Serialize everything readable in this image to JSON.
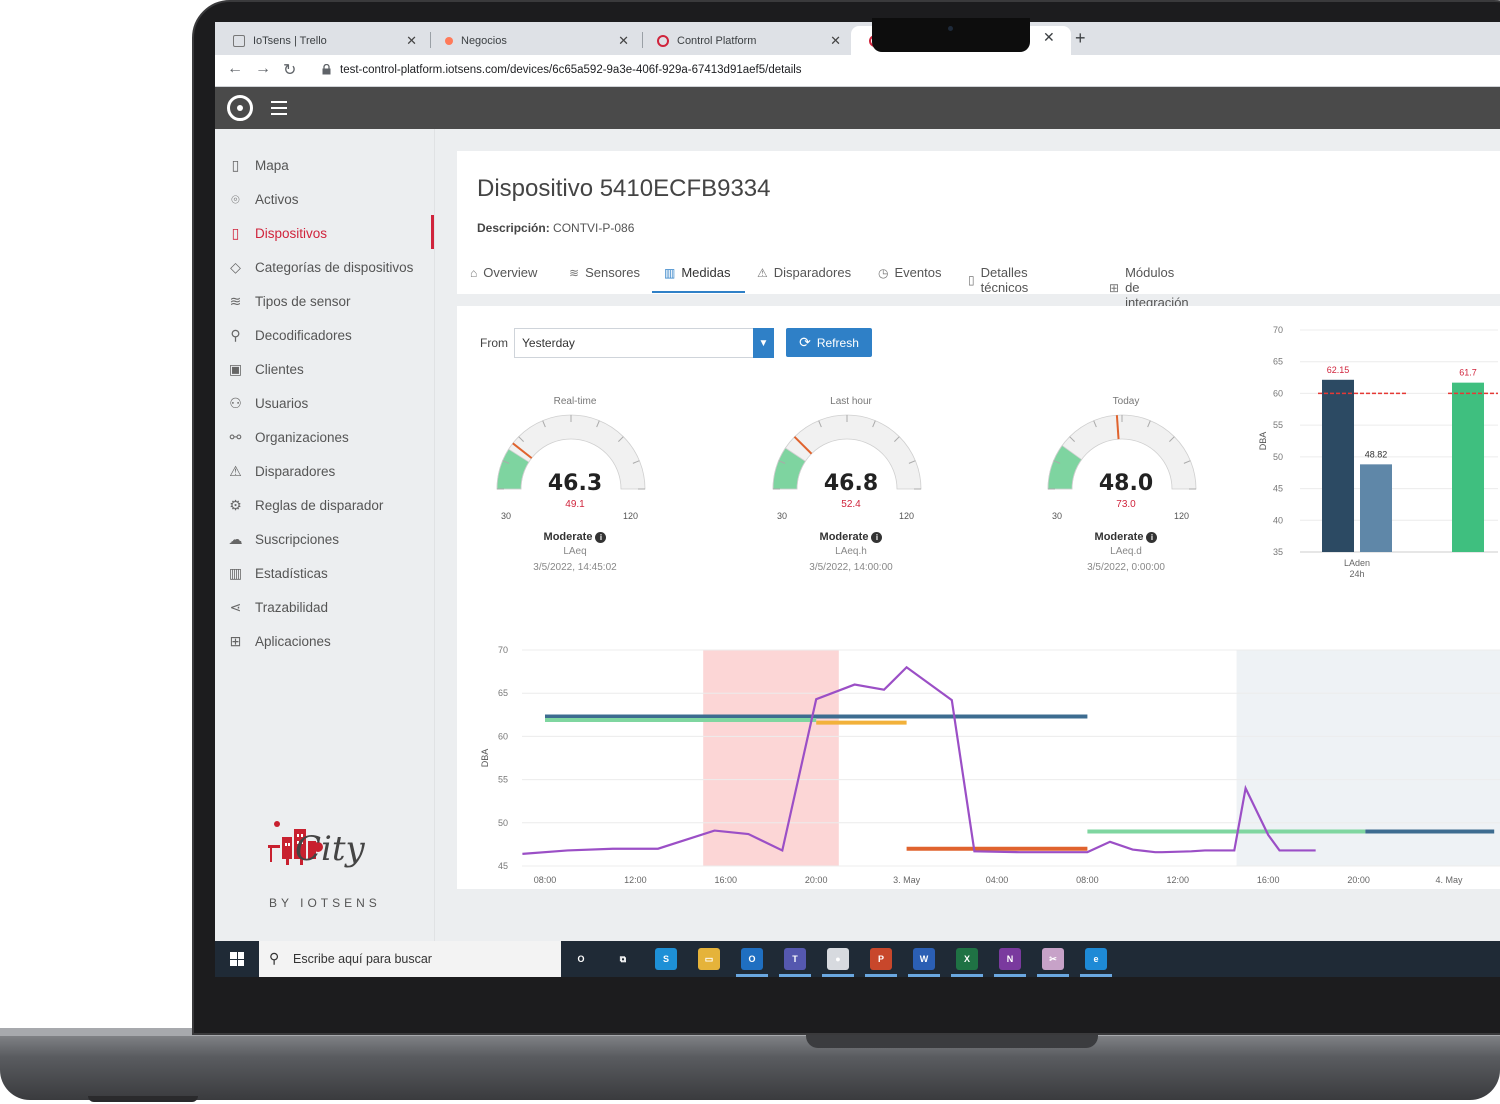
{
  "browser": {
    "tabs": [
      {
        "label": "IoTsens | Trello",
        "color": "#9aa0a6"
      },
      {
        "label": "Negocios",
        "color": "#ff7a59"
      },
      {
        "label": "Control Platform",
        "color": "#d0243c"
      }
    ],
    "url": "test-control-platform.iotsens.com/devices/6c65a592-9a3e-406f-929a-67413d91aef5/details"
  },
  "sidebar": {
    "items": [
      {
        "label": "Mapa",
        "icon": "map-icon"
      },
      {
        "label": "Activos",
        "icon": "location-pin-icon"
      },
      {
        "label": "Dispositivos",
        "icon": "device-icon"
      },
      {
        "label": "Categorías de dispositivos",
        "icon": "tag-icon"
      },
      {
        "label": "Tipos de sensor",
        "icon": "wifi-icon"
      },
      {
        "label": "Decodificadores",
        "icon": "key-icon"
      },
      {
        "label": "Clientes",
        "icon": "briefcase-icon"
      },
      {
        "label": "Usuarios",
        "icon": "users-icon"
      },
      {
        "label": "Organizaciones",
        "icon": "org-chart-icon"
      },
      {
        "label": "Disparadores",
        "icon": "warning-icon"
      },
      {
        "label": "Reglas de disparador",
        "icon": "gear-icon"
      },
      {
        "label": "Suscripciones",
        "icon": "cloud-upload-icon"
      },
      {
        "label": "Estadísticas",
        "icon": "bar-chart-icon"
      },
      {
        "label": "Trazabilidad",
        "icon": "share-icon"
      },
      {
        "label": "Aplicaciones",
        "icon": "grid-icon"
      }
    ],
    "brand_word": "City",
    "brand_by": "BY IOTSENS"
  },
  "device": {
    "title": "Dispositivo 5410ECFB9334",
    "description_label": "Descripción:",
    "description_value": "CONTVI-P-086",
    "tabs": [
      {
        "label": "Overview",
        "icon": "home-icon"
      },
      {
        "label": "Sensores",
        "icon": "wifi-icon"
      },
      {
        "label": "Medidas",
        "icon": "bar-chart-icon"
      },
      {
        "label": "Disparadores",
        "icon": "warning-icon"
      },
      {
        "label": "Eventos",
        "icon": "clock-icon"
      },
      {
        "label": "Detalles técnicos",
        "icon": "document-icon"
      },
      {
        "label": "Módulos de integración",
        "icon": "grid-icon"
      }
    ]
  },
  "filters": {
    "from_label": "From",
    "from_value": "Yesterday",
    "refresh_label": "Refresh"
  },
  "gauges": [
    {
      "title": "Real-time",
      "value": "46.3",
      "max": "49.1",
      "min_label": "30",
      "max_label": "120",
      "level": "Moderate",
      "metric": "LAeq",
      "date": "3/5/2022, 14:45:02",
      "fraction": 0.181,
      "marker": 0.212
    },
    {
      "title": "Last hour",
      "value": "46.8",
      "max": "52.4",
      "min_label": "30",
      "max_label": "120",
      "level": "Moderate",
      "metric": "LAeq.h",
      "date": "3/5/2022, 14:00:00",
      "fraction": 0.187,
      "marker": 0.249
    },
    {
      "title": "Today",
      "value": "48.0",
      "max": "73.0",
      "min_label": "30",
      "max_label": "120",
      "level": "Moderate",
      "metric": "LAeq.d",
      "date": "3/5/2022, 0:00:00",
      "fraction": 0.2,
      "marker": 0.478
    }
  ],
  "chart_data": [
    {
      "type": "bar",
      "ylabel": "DBA",
      "ylim": [
        35,
        70
      ],
      "yticks": [
        35,
        40,
        45,
        50,
        55,
        60,
        65,
        70
      ],
      "categories": [
        "LAden\n24h",
        ""
      ],
      "series": [
        {
          "values": [
            62.15,
            61.7
          ],
          "color": "#2c4a63",
          "labels": [
            "62.15",
            "61.7"
          ]
        },
        {
          "values": [
            48.82,
            null
          ],
          "color": "#5f87a8",
          "labels": [
            "48.82",
            ""
          ]
        }
      ],
      "threshold": 60,
      "threshold_color": "#e53935"
    },
    {
      "type": "line",
      "ylabel": "DBA",
      "ylim": [
        45,
        70
      ],
      "yticks": [
        45,
        50,
        55,
        60,
        65,
        70
      ],
      "xtick_labels": [
        "08:00",
        "12:00",
        "16:00",
        "20:00",
        "3. May",
        "04:00",
        "08:00",
        "12:00",
        "16:00",
        "20:00",
        "4. May"
      ],
      "x_hours": [
        0,
        4,
        8,
        12,
        16,
        20,
        24,
        28,
        32,
        36,
        40
      ],
      "highlight_band": {
        "from": 7.0,
        "to": 13.0,
        "color": "#fcd6d6"
      },
      "future_band": {
        "from": 30.6,
        "to": 42,
        "color": "#eef2f5"
      },
      "series": [
        {
          "color": "#9b4fc6",
          "x": [
            -1,
            1,
            3,
            5,
            7.5,
            9,
            10.5,
            12.0,
            13.7,
            15,
            16.0,
            18,
            19.0,
            21,
            24.0,
            25,
            26,
            27,
            27.3,
            28.6,
            29.2,
            30.5,
            31.0,
            32.0,
            32.5,
            34.1
          ],
          "y": [
            46.4,
            46.8,
            47.0,
            47.0,
            49.1,
            48.7,
            46.8,
            64.3,
            66.0,
            65.4,
            68.0,
            64.2,
            46.7,
            46.6,
            46.6,
            47.8,
            46.9,
            46.6,
            46.6,
            46.7,
            46.8,
            46.8,
            54.0,
            48.6,
            46.8,
            46.8
          ]
        },
        {
          "color": "#3d6c90",
          "x": [
            0,
            24
          ],
          "y": [
            62.3,
            62.3
          ]
        },
        {
          "color": "#7fd6a0",
          "x": [
            0,
            12
          ],
          "y": [
            61.9,
            61.9
          ]
        },
        {
          "color": "#f2b13a",
          "x": [
            12,
            16
          ],
          "y": [
            61.6,
            61.6
          ]
        },
        {
          "color": "#e0632e",
          "x": [
            16,
            24
          ],
          "y": [
            47.0,
            47.0
          ]
        },
        {
          "color": "#7fd6a0",
          "x": [
            24,
            36.3
          ],
          "y": [
            49.0,
            49.0
          ]
        },
        {
          "color": "#3d6c90",
          "x": [
            36.3,
            42
          ],
          "y": [
            49.0,
            49.0
          ]
        }
      ]
    }
  ],
  "taskbar": {
    "search_placeholder": "Escribe aquí para buscar",
    "apps": [
      {
        "name": "cortana-icon",
        "label": "O",
        "color": "transparent"
      },
      {
        "name": "task-view-icon",
        "label": "⧉",
        "color": "transparent"
      },
      {
        "name": "store-icon",
        "label": "S",
        "color": "#1e90d6"
      },
      {
        "name": "file-explorer-icon",
        "label": "▭",
        "color": "#e5b33a"
      },
      {
        "name": "outlook-icon",
        "label": "O",
        "color": "#1f6fc1"
      },
      {
        "name": "teams-icon",
        "label": "T",
        "color": "#5558af"
      },
      {
        "name": "chrome-icon",
        "label": "●",
        "color": "#d7dadf"
      },
      {
        "name": "powerpoint-icon",
        "label": "P",
        "color": "#c8472b"
      },
      {
        "name": "word-icon",
        "label": "W",
        "color": "#2b5fb4"
      },
      {
        "name": "excel-icon",
        "label": "X",
        "color": "#1f7244"
      },
      {
        "name": "onenote-icon",
        "label": "N",
        "color": "#7a3a9e"
      },
      {
        "name": "snip-icon",
        "label": "✂",
        "color": "#c7a2c8"
      },
      {
        "name": "edge-icon",
        "label": "e",
        "color": "#1e8ad6"
      }
    ]
  }
}
